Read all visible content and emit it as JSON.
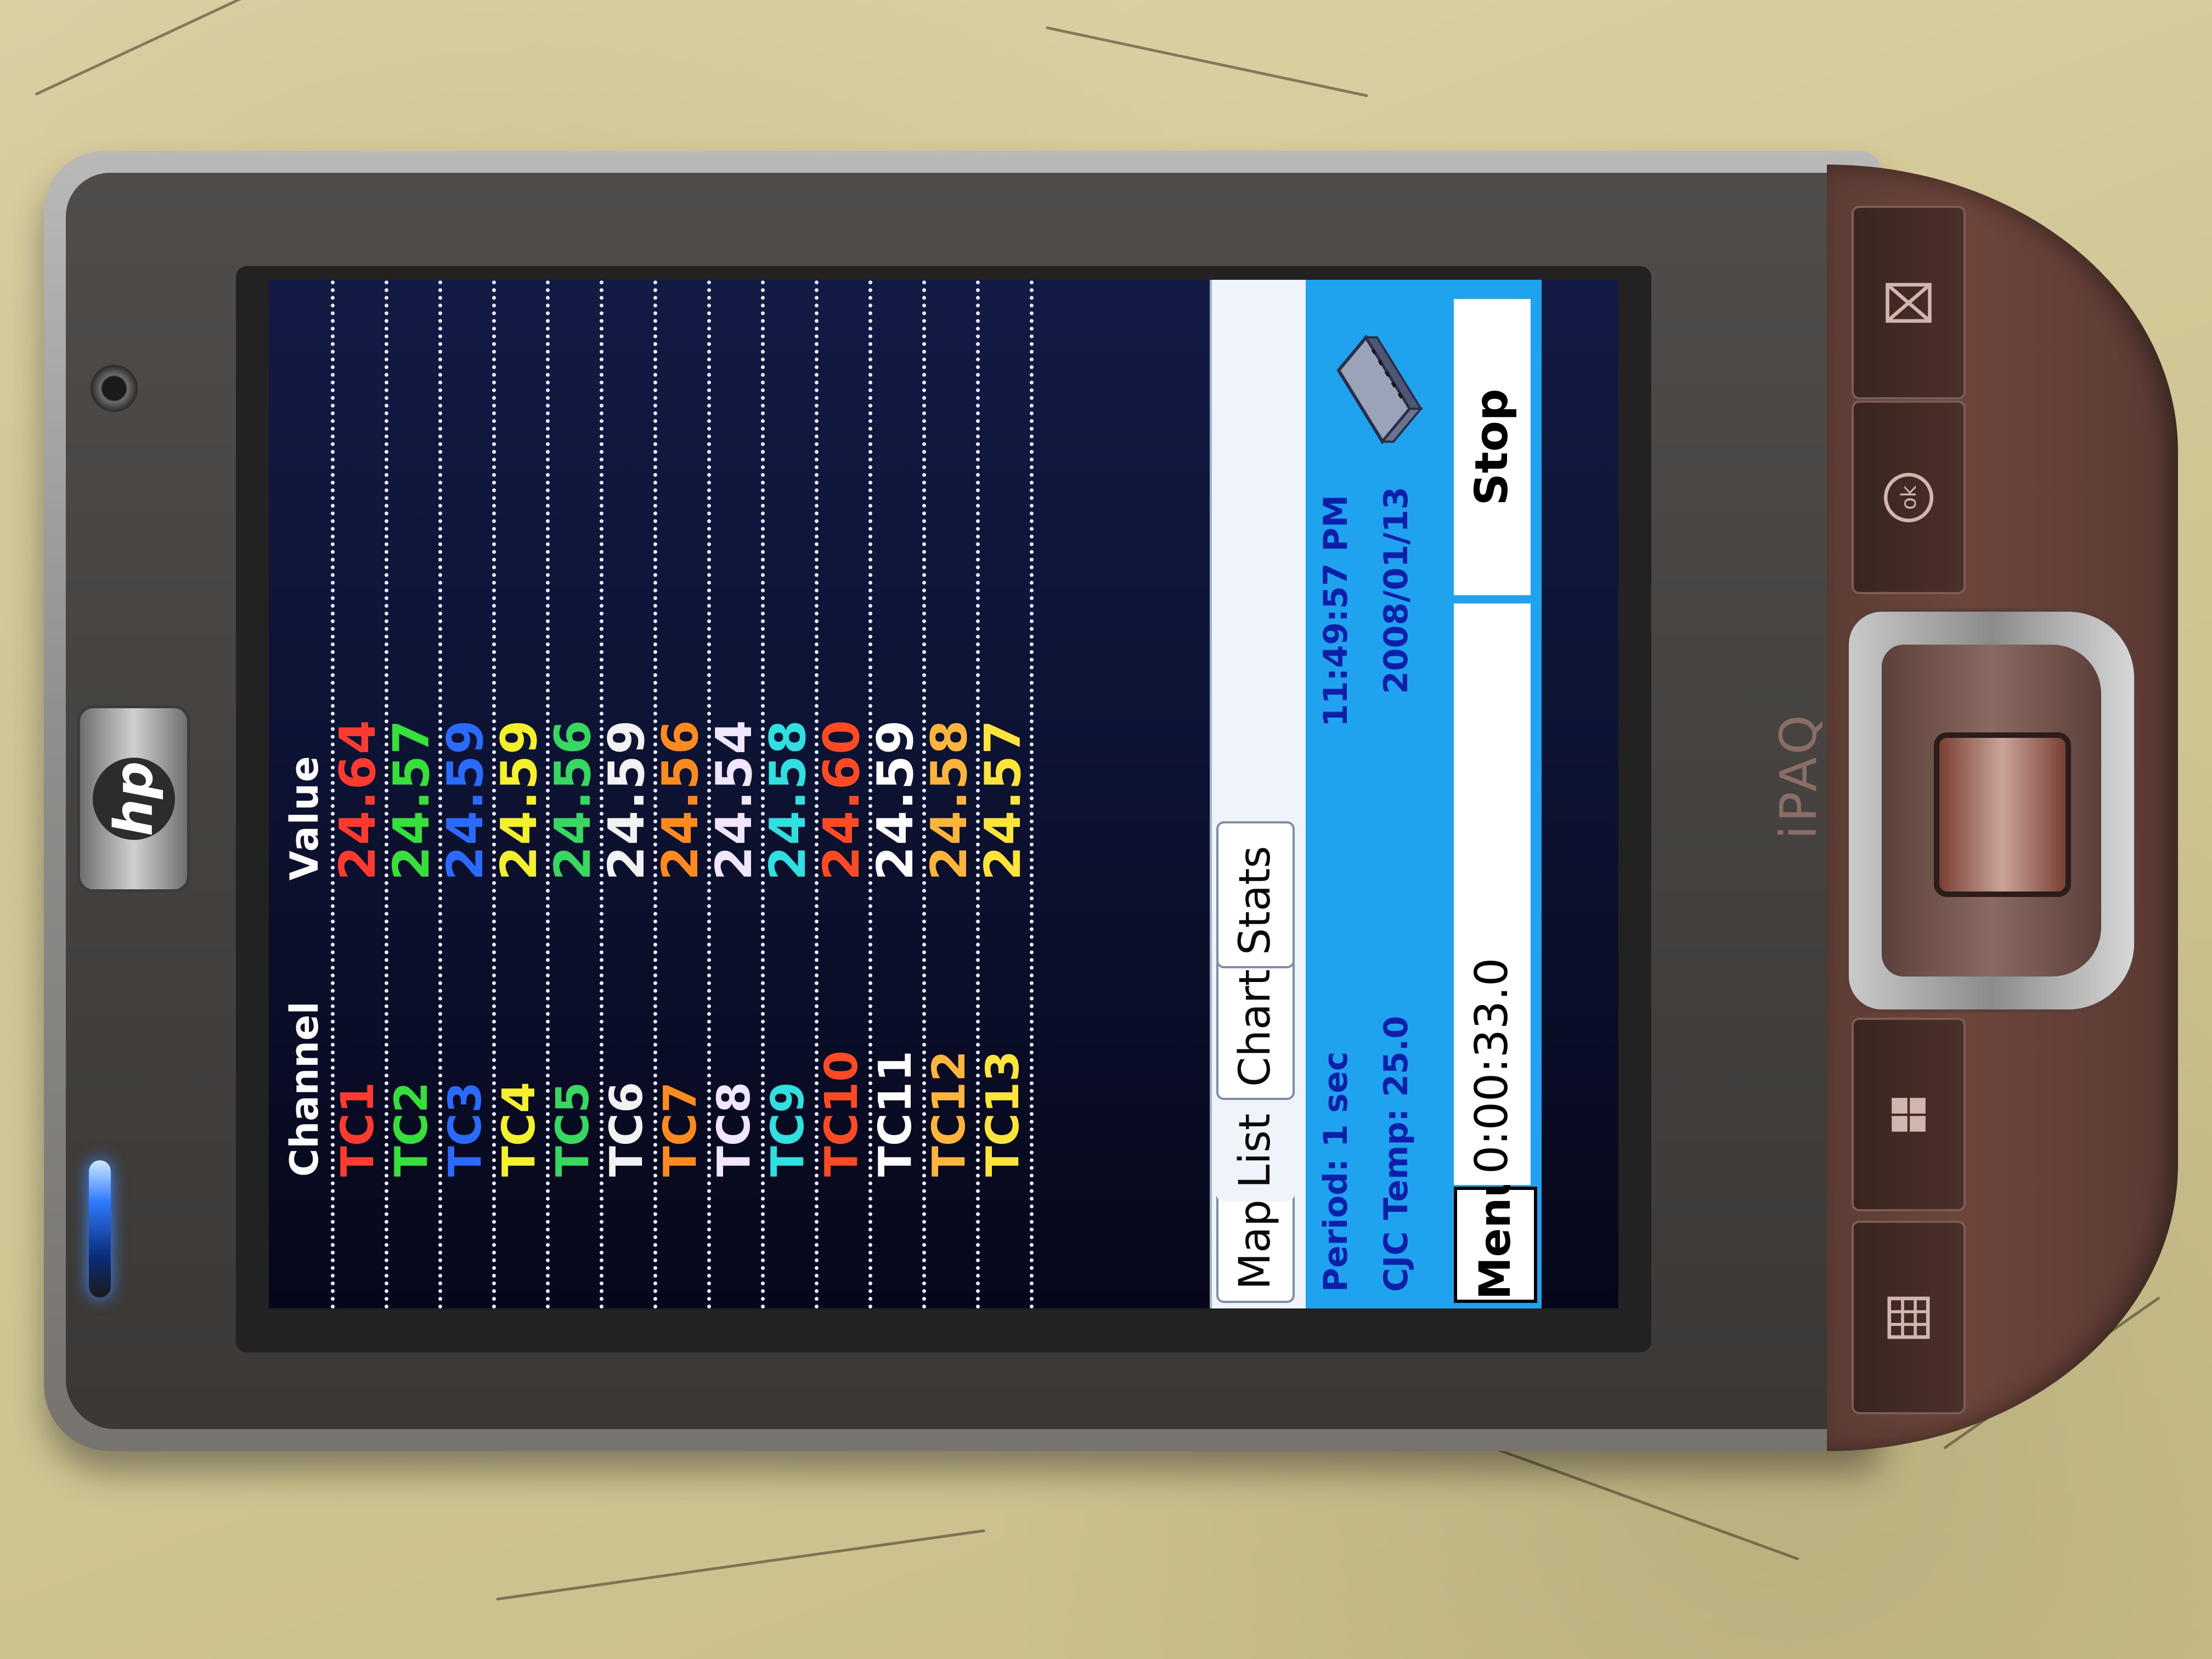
{
  "device": {
    "brand_logo": "hp",
    "model": "iPAQ"
  },
  "table": {
    "header_channel": "Channel",
    "header_value": "Value",
    "rows": [
      {
        "channel": "TC1",
        "value": "24.64",
        "color": "#ff3b30"
      },
      {
        "channel": "TC2",
        "value": "24.57",
        "color": "#35e03a"
      },
      {
        "channel": "TC3",
        "value": "24.59",
        "color": "#2a6bff"
      },
      {
        "channel": "TC4",
        "value": "24.59",
        "color": "#f4f02a"
      },
      {
        "channel": "TC5",
        "value": "24.56",
        "color": "#36d860"
      },
      {
        "channel": "TC6",
        "value": "24.59",
        "color": "#f2f2f2"
      },
      {
        "channel": "TC7",
        "value": "24.56",
        "color": "#ff8a1e"
      },
      {
        "channel": "TC8",
        "value": "24.54",
        "color": "#f0e6ff"
      },
      {
        "channel": "TC9",
        "value": "24.58",
        "color": "#2fe0e0"
      },
      {
        "channel": "TC10",
        "value": "24.60",
        "color": "#ff4a24"
      },
      {
        "channel": "TC11",
        "value": "24.59",
        "color": "#ffffff"
      },
      {
        "channel": "TC12",
        "value": "24.58",
        "color": "#ffb43a"
      },
      {
        "channel": "TC13",
        "value": "24.57",
        "color": "#ffe43a"
      }
    ]
  },
  "tabs": [
    {
      "label": "Map"
    },
    {
      "label": "List"
    },
    {
      "label": "Chart"
    },
    {
      "label": "Stats"
    }
  ],
  "status": {
    "period": "Period: 1 sec",
    "cjc_temp": "CJC Temp: 25.0",
    "time": "11:49:57 PM",
    "date": "2008/01/13"
  },
  "command_bar": {
    "menu_label": "Menu",
    "elapsed": "0:00:33.0",
    "stop_label": "Stop"
  }
}
